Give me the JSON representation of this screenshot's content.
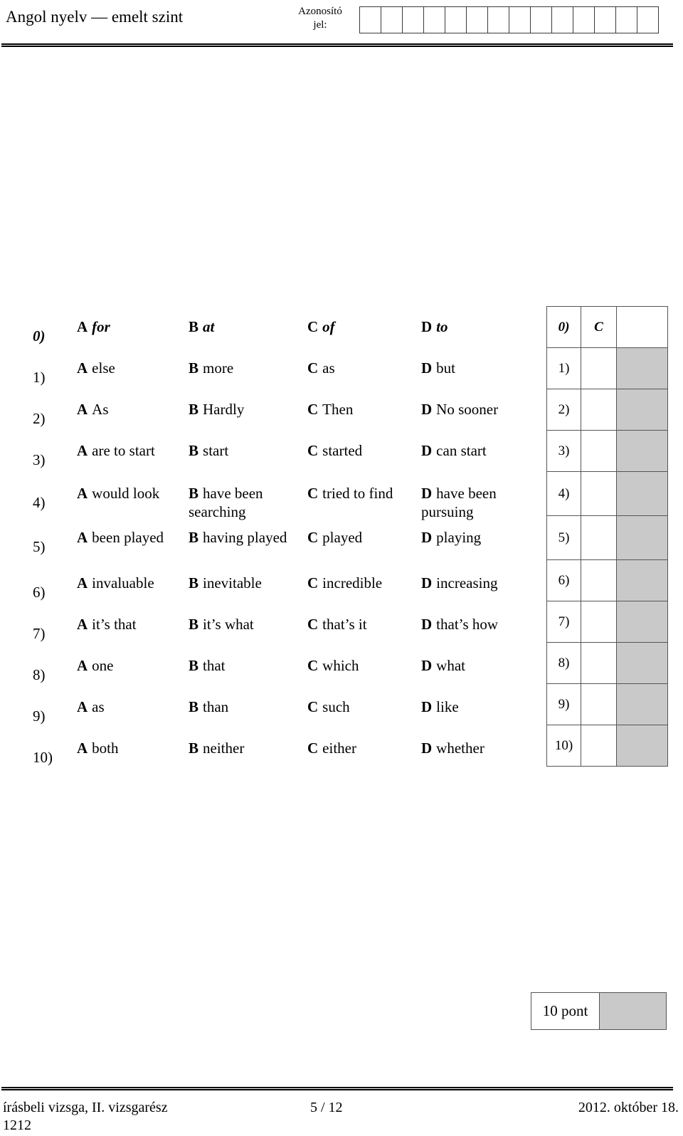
{
  "header": {
    "exam_title": "Angol nyelv — emelt szint",
    "id_label_line1": "Azonosító",
    "id_label_line2": "jel:",
    "id_box_count": 14
  },
  "questions": [
    {
      "number": "0)",
      "is_example": true,
      "options": {
        "a": "for",
        "b": "at",
        "c": "of",
        "d": "to"
      },
      "letters": {
        "a": "A",
        "b": "B",
        "c": "C",
        "d": "D"
      }
    },
    {
      "number": "1)",
      "is_example": false,
      "options": {
        "a": "else",
        "b": "more",
        "c": "as",
        "d": "but"
      },
      "letters": {
        "a": "A",
        "b": "B",
        "c": "C",
        "d": "D"
      }
    },
    {
      "number": "2)",
      "is_example": false,
      "options": {
        "a": "As",
        "b": "Hardly",
        "c": "Then",
        "d": "No sooner"
      },
      "letters": {
        "a": "A",
        "b": "B",
        "c": "C",
        "d": "D"
      }
    },
    {
      "number": "3)",
      "is_example": false,
      "options": {
        "a": "are to start",
        "b": "start",
        "c": "started",
        "d": "can start"
      },
      "letters": {
        "a": "A",
        "b": "B",
        "c": "C",
        "d": "D"
      }
    },
    {
      "number": "4)",
      "is_example": false,
      "options": {
        "a": "would look",
        "b": "have been searching",
        "c": "tried to find",
        "d": "have been pursuing"
      },
      "letters": {
        "a": "A",
        "b": "B",
        "c": "C",
        "d": "D"
      }
    },
    {
      "number": "5)",
      "is_example": false,
      "options": {
        "a": "been played",
        "b": "having played",
        "c": "played",
        "d": "playing"
      },
      "letters": {
        "a": "A",
        "b": "B",
        "c": "C",
        "d": "D"
      }
    },
    {
      "number": "6)",
      "is_example": false,
      "options": {
        "a": "invaluable",
        "b": "inevitable",
        "c": "incredible",
        "d": "increasing"
      },
      "letters": {
        "a": "A",
        "b": "B",
        "c": "C",
        "d": "D"
      }
    },
    {
      "number": "7)",
      "is_example": false,
      "options": {
        "a": "it’s that",
        "b": "it’s what",
        "c": "that’s it",
        "d": "that’s how"
      },
      "letters": {
        "a": "A",
        "b": "B",
        "c": "C",
        "d": "D"
      }
    },
    {
      "number": "8)",
      "is_example": false,
      "options": {
        "a": "one",
        "b": "that",
        "c": "which",
        "d": "what"
      },
      "letters": {
        "a": "A",
        "b": "B",
        "c": "C",
        "d": "D"
      }
    },
    {
      "number": "9)",
      "is_example": false,
      "options": {
        "a": "as",
        "b": "than",
        "c": "such",
        "d": "like"
      },
      "letters": {
        "a": "A",
        "b": "B",
        "c": "C",
        "d": "D"
      }
    },
    {
      "number": "10)",
      "is_example": false,
      "options": {
        "a": "both",
        "b": "neither",
        "c": "either",
        "d": "whether"
      },
      "letters": {
        "a": "A",
        "b": "B",
        "c": "C",
        "d": "D"
      }
    }
  ],
  "answer_table": {
    "rows": [
      {
        "number": "0)",
        "answer": "C",
        "is_example": true,
        "has_gray": false
      },
      {
        "number": "1)",
        "answer": "",
        "is_example": false,
        "has_gray": true
      },
      {
        "number": "2)",
        "answer": "",
        "is_example": false,
        "has_gray": true
      },
      {
        "number": "3)",
        "answer": "",
        "is_example": false,
        "has_gray": true
      },
      {
        "number": "4)",
        "answer": "",
        "is_example": false,
        "has_gray": true
      },
      {
        "number": "5)",
        "answer": "",
        "is_example": false,
        "has_gray": true
      },
      {
        "number": "6)",
        "answer": "",
        "is_example": false,
        "has_gray": true
      },
      {
        "number": "7)",
        "answer": "",
        "is_example": false,
        "has_gray": true
      },
      {
        "number": "8)",
        "answer": "",
        "is_example": false,
        "has_gray": true
      },
      {
        "number": "9)",
        "answer": "",
        "is_example": false,
        "has_gray": true
      },
      {
        "number": "10)",
        "answer": "",
        "is_example": false,
        "has_gray": true
      }
    ]
  },
  "points_box": {
    "label": "10 pont",
    "score": ""
  },
  "footer": {
    "left": "írásbeli vizsga, II. vizsgarész",
    "code": "1212",
    "page": "5 / 12",
    "date": "2012. október 18."
  },
  "colors": {
    "gray_cell": "#c9c9c9",
    "border": "#555555",
    "rule": "#000000"
  }
}
